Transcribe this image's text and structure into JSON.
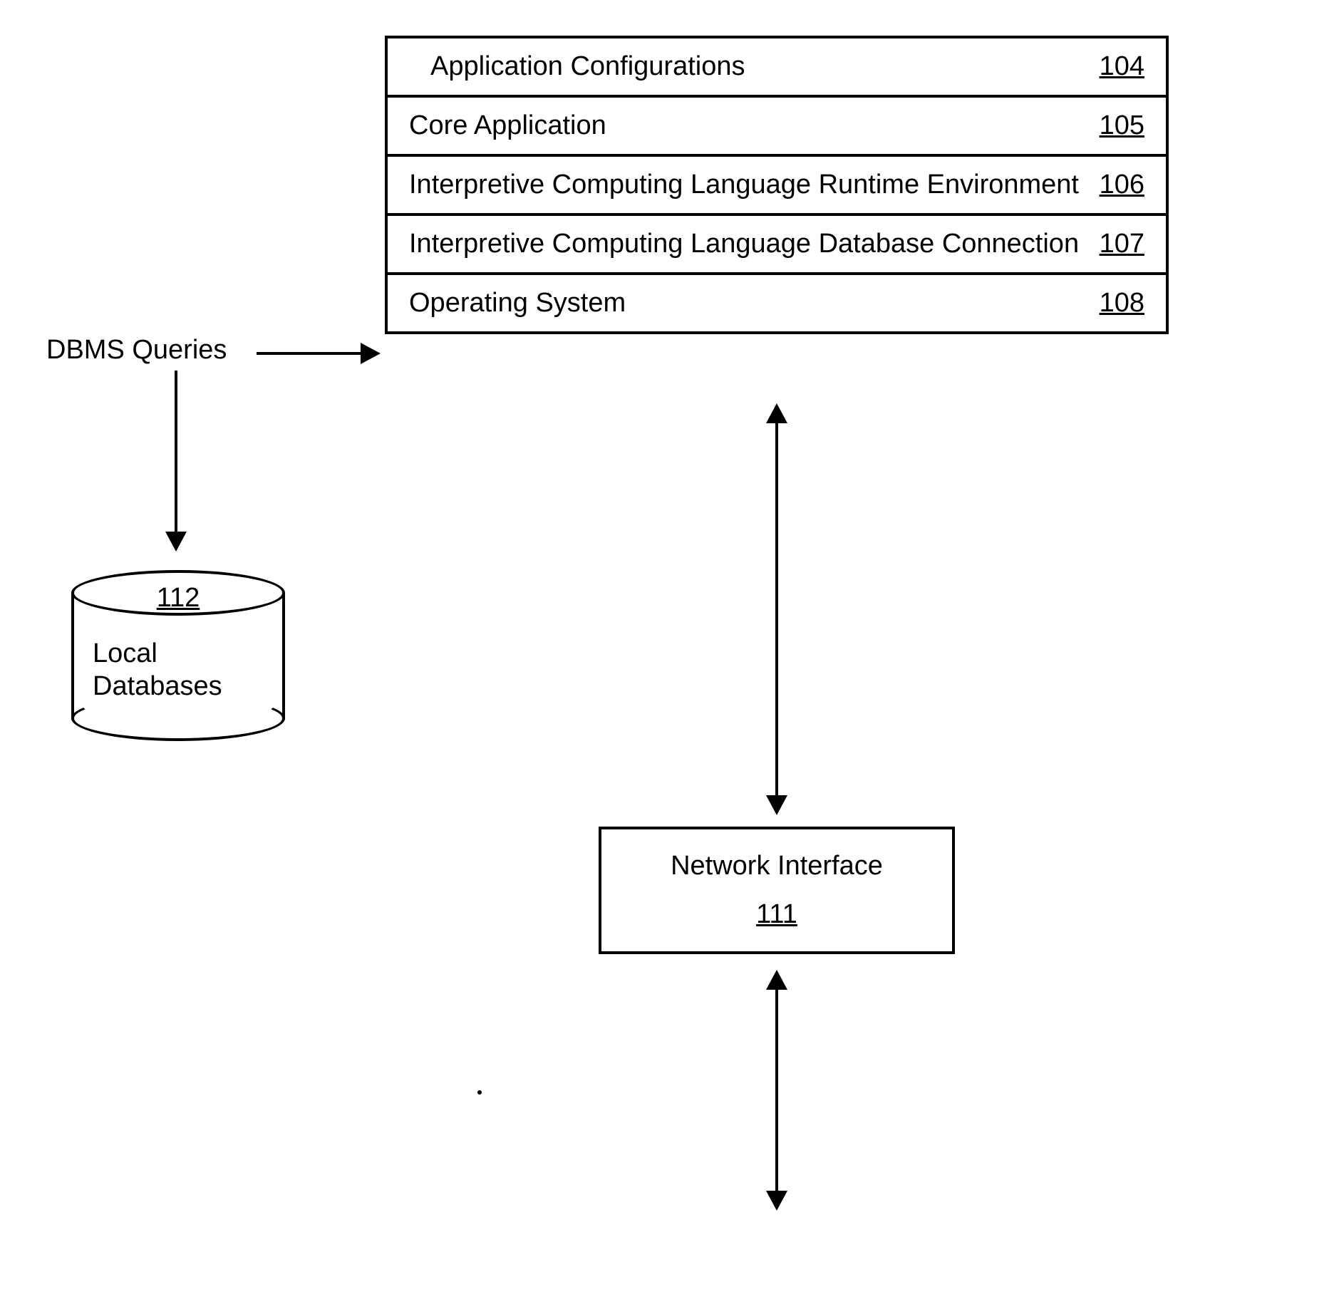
{
  "stack": {
    "row1": {
      "label": "Application Configurations",
      "num": "104"
    },
    "row2": {
      "label": "Core Application",
      "num": "105"
    },
    "row3": {
      "label": "Interpretive Computing Language Runtime Environment",
      "num": "106"
    },
    "row4": {
      "label": "Interpretive Computing Language Database Connection",
      "num": "107"
    },
    "row5": {
      "label": "Operating System",
      "num": "108"
    }
  },
  "dbms_label": "DBMS Queries",
  "cylinder": {
    "num": "112",
    "label_line1": "Local",
    "label_line2": "Databases"
  },
  "network": {
    "label": "Network Interface",
    "num": "111"
  }
}
